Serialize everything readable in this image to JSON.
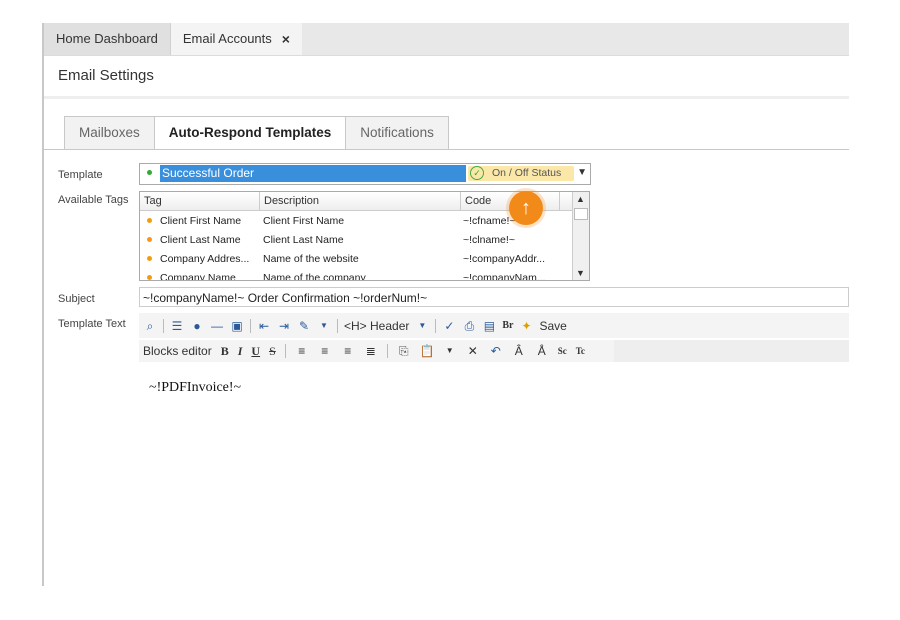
{
  "top_tabs": [
    {
      "label": "Home Dashboard"
    },
    {
      "label": "Email Accounts",
      "close": "×"
    }
  ],
  "page_title": "Email Settings",
  "sub_tabs": [
    {
      "label": "Mailboxes"
    },
    {
      "label": "Auto-Respond Templates"
    },
    {
      "label": "Notifications"
    }
  ],
  "form": {
    "template_label": "Template",
    "template_value": "Successful Order",
    "status_label": "On / Off Status",
    "tags_label": "Available Tags",
    "subject_label": "Subject",
    "subject_value": "~!companyName!~ Order Confirmation ~!orderNum!~",
    "text_label": "Template Text"
  },
  "tags_grid": {
    "columns": [
      "Tag",
      "Description",
      "Code"
    ],
    "rows": [
      {
        "tag": "Client First Name",
        "desc": "Client First Name",
        "code": "~!cfname!~"
      },
      {
        "tag": "Client Last Name",
        "desc": "Client Last Name",
        "code": "~!clname!~"
      },
      {
        "tag": "Company Addres...",
        "desc": "Name of the website",
        "code": "~!companyAddr..."
      },
      {
        "tag": "Company Name",
        "desc": "Name of the company",
        "code": "~!companyNam..."
      }
    ]
  },
  "toolbar": {
    "header_label": "<H> Header",
    "save_label": "Save",
    "blocks_label": "Blocks editor",
    "bold": "B",
    "italic": "I",
    "underline": "U",
    "strike": "S",
    "br": "Br",
    "sc": "Sc",
    "tc": "Tc"
  },
  "editor_content": "~!PDFInvoice!~",
  "colors": {
    "accent": "#f28a1a",
    "selection": "#3a8fdc",
    "status_bg": "#fbe8a8"
  }
}
